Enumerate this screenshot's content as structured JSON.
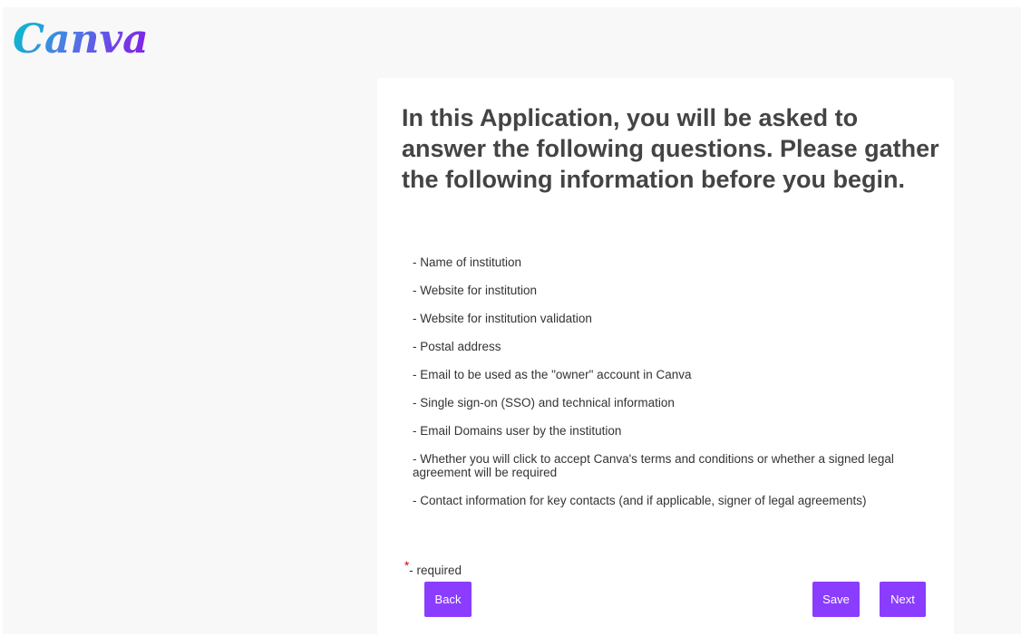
{
  "brand": {
    "logo_text": "Canva",
    "gradient_start": "#00c4cc",
    "gradient_mid": "#4d7be6",
    "gradient_end": "#7d2ae8"
  },
  "accent_color": "#8b3dff",
  "required_color": "#d0021b",
  "card": {
    "heading": "In this Application, you will be asked to answer the following questions. Please gather the following information before you begin.",
    "items": [
      "- Name of institution",
      "- Website for institution",
      "- Website for institution validation",
      "- Postal address",
      "- Email to be used as the \"owner\" account in Canva",
      "- Single sign-on (SSO) and technical information",
      "- Email Domains user by the institution",
      "- Whether you will click to accept Canva's terms and conditions or whether a signed legal agreement will be required",
      "- Contact information for key contacts (and if applicable, signer of legal agreements)"
    ],
    "required_star": "*",
    "required_text": "- required"
  },
  "buttons": {
    "back": "Back",
    "save": "Save",
    "next": "Next"
  }
}
